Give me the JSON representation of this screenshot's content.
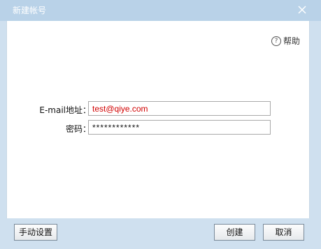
{
  "window": {
    "title": "新建帐号"
  },
  "help": {
    "icon": "question-circle-icon",
    "label": "帮助"
  },
  "form": {
    "email_label": "E-mail地址：",
    "email_value": "test@qiye.com",
    "password_label": "密码：",
    "password_value": "************"
  },
  "footer": {
    "manual_label": "手动设置",
    "create_label": "创建",
    "cancel_label": "取消"
  },
  "colors": {
    "titlebar": "#b9d2e8",
    "frame": "#cfe0ef",
    "email_text": "#d10000"
  }
}
